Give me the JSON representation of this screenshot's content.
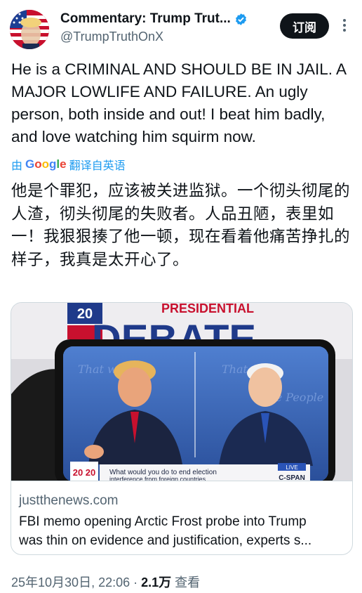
{
  "author": {
    "display_name": "Commentary: Trump Trut...",
    "handle": "@TrumpTruthOnX",
    "subscribe_label": "订阅"
  },
  "tweet": {
    "text": "He is a CRIMINAL AND SHOULD BE IN JAIL. A MAJOR LOWLIFE AND FAILURE. An ugly person, both inside and out! I beat him badly, and love watching him squirm now.",
    "translated_prefix": "由",
    "translated_brand": "Google",
    "translated_suffix": "翻译自英语",
    "translation": "他是个罪犯，应该被关进监狱。一个彻头彻尾的人渣，彻头彻尾的失败者。人品丑陋，表里如一！我狠狠揍了他一顿，现在看着他痛苦挣扎的样子，我真是太开心了。"
  },
  "card": {
    "image_text": {
      "year": "20",
      "top_banner": "PRESIDENTIAL",
      "headline": "DEBATE",
      "chyron": "What would you do to end election",
      "chyron_2": "interference from foreign countries",
      "live": "LIVE",
      "network": "C-SPAN",
      "logo": "20 20"
    },
    "domain": "justthenews.com",
    "title_line1": "FBI memo opening Arctic Frost probe into Trump",
    "title_line2": "was thin on evidence and justification, experts s..."
  },
  "meta": {
    "timestamp": "25年10月30日, 22:06 · ",
    "views_count": "2.1万",
    "views_label": " 查看"
  },
  "colors": {
    "accent": "#1d9bf0",
    "text": "#0f1419",
    "secondary": "#536471"
  }
}
